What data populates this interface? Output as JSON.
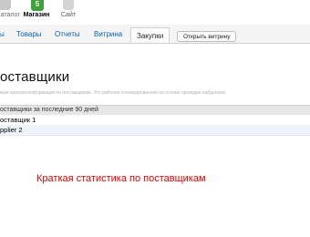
{
  "apps": {
    "left_label": "аталог",
    "shop_label": "Магазин",
    "shop_badge": "5",
    "site_label": "Сайт"
  },
  "tabs": [
    {
      "label": "ы"
    },
    {
      "label": "Товары"
    },
    {
      "label": "Отчеты"
    },
    {
      "label": "Витрина"
    },
    {
      "label": "Закупки"
    }
  ],
  "open_storefront_label": "Открыть витрину",
  "page": {
    "title": "оставщики",
    "subtitle": "мые краткая информация по поставщикам. Это рабочее сгенерированное на основе проводки найденная."
  },
  "table": {
    "header": "оставщики за последние 90 дней",
    "rows": [
      {
        "name": "оставщик 1"
      },
      {
        "name": "pplier 2"
      }
    ]
  },
  "annotation": "Краткая статистика по поставщикам",
  "colors": {
    "link": "#0b63b5",
    "annotation": "#e00000",
    "shop_icon": "#3fa13a"
  }
}
